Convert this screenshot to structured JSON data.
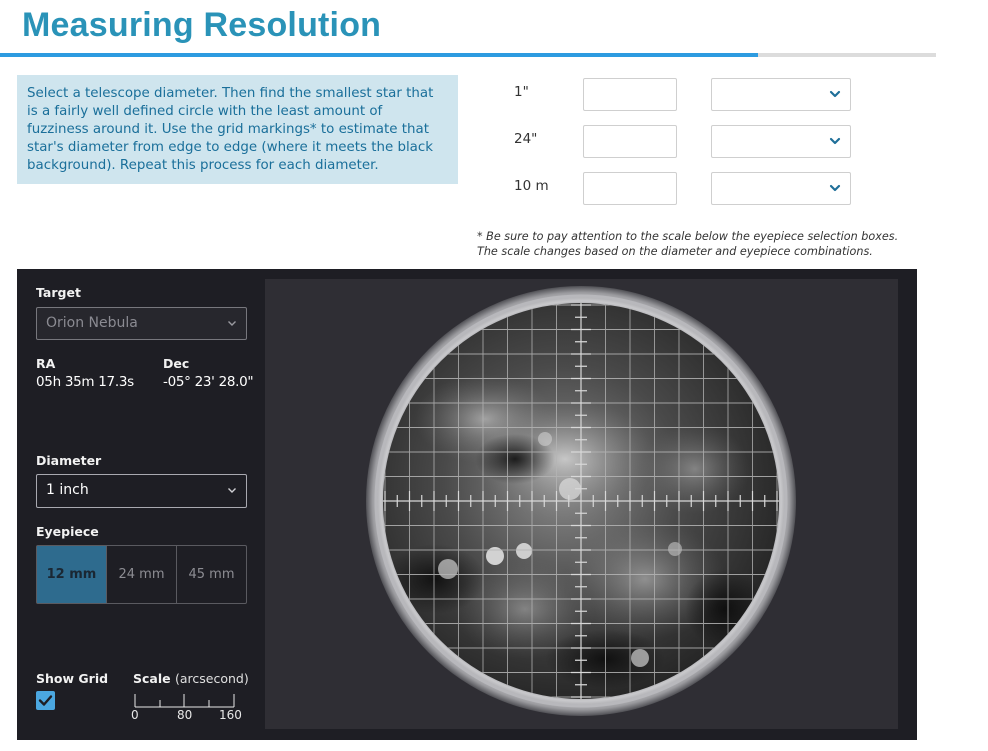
{
  "page": {
    "title": "Measuring Resolution",
    "progress_percent": 81
  },
  "instructions": {
    "text": "Select a telescope diameter. Then find the smallest star that is a fairly well defined circle with the least amount of fuzziness around it. Use the grid markings* to estimate that star's diameter from edge to edge (where it meets the black background). Repeat this process for each diameter."
  },
  "answers": [
    {
      "label": "1\"",
      "value": "",
      "selected": ""
    },
    {
      "label": "24\"",
      "value": "",
      "selected": ""
    },
    {
      "label": "10 m",
      "value": "",
      "selected": ""
    }
  ],
  "footnote": {
    "line1": "* Be sure to pay attention to the scale below the eyepiece selection boxes.",
    "line2": "The scale changes based on the diameter and eyepiece combinations."
  },
  "sidebar": {
    "target_label": "Target",
    "target_value": "Orion Nebula",
    "ra_label": "RA",
    "ra_value": "05h 35m 17.3s",
    "dec_label": "Dec",
    "dec_value": "-05° 23' 28.0\"",
    "diameter_label": "Diameter",
    "diameter_value": "1 inch",
    "eyepiece_label": "Eyepiece",
    "eyepieces": [
      "12 mm",
      "24 mm",
      "45 mm"
    ],
    "eyepiece_selected": "12 mm",
    "show_grid_label": "Show Grid",
    "show_grid_checked": true,
    "scale_label": "Scale",
    "scale_unit": "(arcsecond)",
    "scale_ticks": [
      "0",
      "80",
      "160"
    ]
  },
  "colors": {
    "title": "#2a93b8",
    "accent": "#2d9be0",
    "instructions_bg": "#cfe5ee",
    "panel_bg": "#1e1e24",
    "eyepiece_active": "#2e6b8e"
  },
  "icons": {
    "select_chevron": "chevron-down-icon",
    "checkbox": "checkmark-icon"
  }
}
